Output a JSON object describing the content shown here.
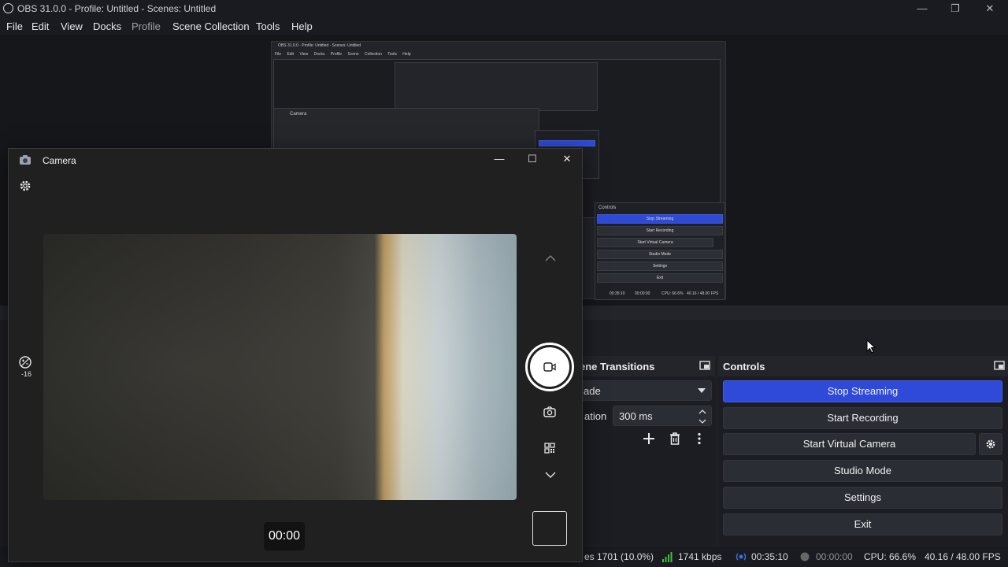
{
  "obs": {
    "title": "OBS 31.0.0 - Profile: Untitled - Scenes: Untitled",
    "menu": [
      "File",
      "Edit",
      "View",
      "Docks",
      "Profile",
      "Scene Collection",
      "Tools",
      "Help"
    ],
    "preview_mini": {
      "title": "OBS 31.0.0 - Profile: Untitled - Scenes: Untitled",
      "menu": [
        "File",
        "Edit",
        "View",
        "Docks",
        "Profile",
        "Scene Collection",
        "Tools",
        "Help"
      ],
      "camera_title": "Camera",
      "controls_title": "Controls",
      "buttons": [
        "Stop Streaming",
        "Start Recording",
        "Start Virtual Camera",
        "Studio Mode",
        "Settings",
        "Exit"
      ],
      "status": [
        "00:35:10",
        "00:00:00",
        "CPU: 66.6%",
        "40.16 / 48.00 FPS"
      ]
    },
    "scene_transitions": {
      "title": "ene Transitions",
      "transition_value": "ade",
      "duration_label": "ation",
      "duration_value": "300 ms"
    },
    "controls": {
      "title": "Controls",
      "stop_streaming": "Stop Streaming",
      "start_recording": "Start Recording",
      "start_virtual_camera": "Start Virtual Camera",
      "studio_mode": "Studio Mode",
      "settings": "Settings",
      "exit": "Exit"
    },
    "status": {
      "dropped": "es 1701 (10.0%)",
      "bitrate": "1741 kbps",
      "stream_time": "00:35:10",
      "record_time": "00:00:00",
      "cpu": "CPU: 66.6%",
      "fps": "40.16 / 48.00 FPS"
    },
    "colors": {
      "accent": "#2f49d8",
      "bg": "#1e1f24",
      "signal_green": "#3fbf3f"
    }
  },
  "camera": {
    "title": "Camera",
    "timer": "00:00",
    "exposure_value": "-16",
    "icons": [
      "camera-app-icon",
      "gear-icon",
      "exposure-icon",
      "video-mode-icon",
      "photo-mode-icon",
      "qr-code-icon",
      "chevron-up-icon",
      "chevron-down-icon"
    ]
  }
}
